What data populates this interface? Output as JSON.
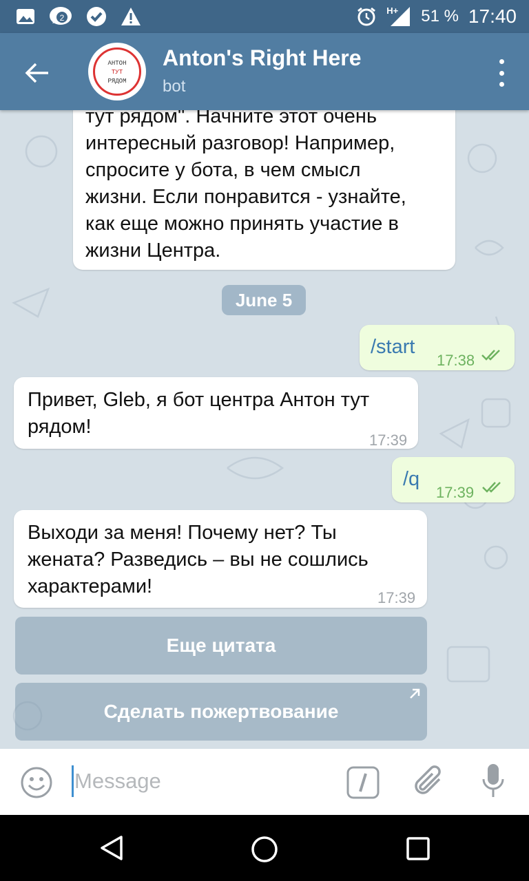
{
  "status_bar": {
    "notifications": [
      "image-icon",
      "count-badge-icon",
      "check-badge-icon",
      "warning-icon"
    ],
    "badge_count": "2",
    "network": "H+",
    "battery": "51 %",
    "time": "17:40"
  },
  "header": {
    "title": "Anton's Right Here",
    "subtitle": "bot",
    "avatar_text_1": "АНТОН",
    "avatar_text_2": "ТУТ",
    "avatar_text_3": "РЯДОМ"
  },
  "messages": [
    {
      "direction": "in",
      "lines": [
        "тут рядом\". Начните этот очень",
        "интересный разговор! Например,",
        "спросите у бота, в чем смысл",
        "жизни. Если понравится - узнайте,",
        "как еще можно принять участие в",
        "жизни Центра."
      ]
    },
    {
      "direction": "out",
      "text": "/start",
      "time": "17:38",
      "read": true
    },
    {
      "direction": "in",
      "lines": [
        "Привет, Gleb, я бот центра Антон тут",
        "рядом!"
      ],
      "time": "17:39"
    },
    {
      "direction": "out",
      "text": "/q",
      "time": "17:39",
      "read": true
    },
    {
      "direction": "in",
      "lines": [
        "Выходи за меня! Почему нет? Ты",
        "жената? Разведись – вы не сошлись",
        "характерами!"
      ],
      "time": "17:39"
    }
  ],
  "date_separator": "June 5",
  "keyboard_buttons": [
    "Еще цитата",
    "Сделать пожертвование"
  ],
  "input": {
    "placeholder": "Message",
    "value": ""
  },
  "colors": {
    "header": "#517da2",
    "statusbar": "#3f6688",
    "chat_bg": "#d5dfe6",
    "out_bubble": "#effdde",
    "accent": "#6db25f"
  }
}
